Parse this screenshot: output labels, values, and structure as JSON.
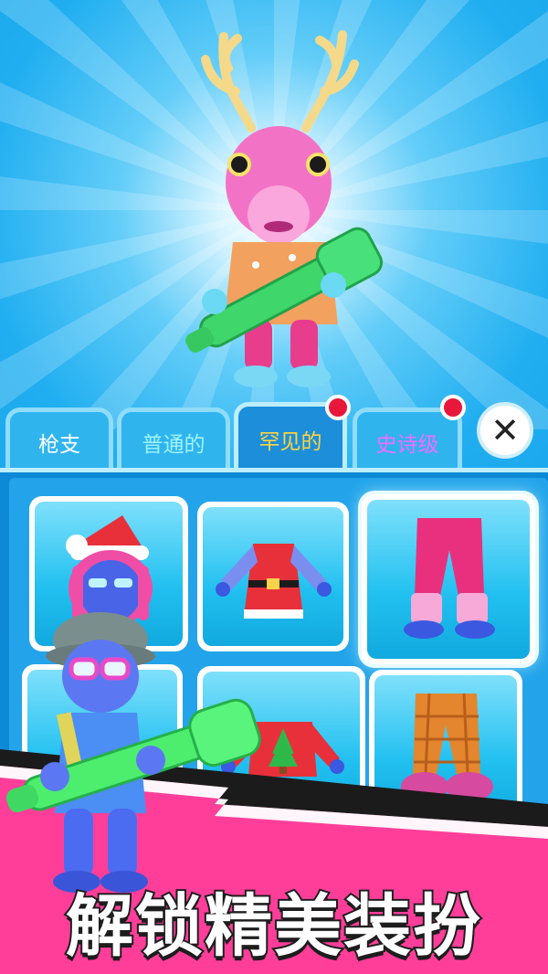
{
  "tabs": [
    {
      "label": "枪支",
      "color": "#ffffff",
      "active": false,
      "badge": false
    },
    {
      "label": "普通的",
      "color": "#9ff4ff",
      "active": false,
      "badge": false
    },
    {
      "label": "罕见的",
      "color": "#ffd43b",
      "active": true,
      "badge": true
    },
    {
      "label": "史诗级",
      "color": "#f06cff",
      "active": false,
      "badge": true
    }
  ],
  "close_icon": "close-icon",
  "items": [
    {
      "name": "santa-hat-pink-hair-head",
      "selected": false
    },
    {
      "name": "red-christmas-dress-top",
      "selected": false
    },
    {
      "name": "pink-pants-with-boots",
      "selected": true
    },
    {
      "name": "locked-item",
      "selected": false
    },
    {
      "name": "christmas-tree-sweater-top",
      "selected": false
    },
    {
      "name": "plaid-pants-with-slippers",
      "selected": false
    }
  ],
  "banner": {
    "text": "解锁精美装扮"
  },
  "colors": {
    "accent": "#ffd43b",
    "badge": "#e8183a",
    "sky": "#1aa9ec",
    "banner_pink": "#ff3e9a"
  }
}
